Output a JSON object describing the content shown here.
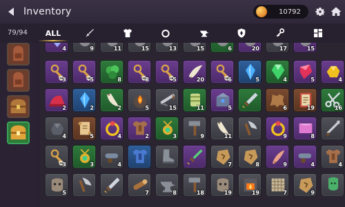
{
  "header": {
    "title": "Inventory",
    "coins": "10792"
  },
  "tabs": {
    "capacity": "79/94",
    "all_label": "ALL",
    "items": [
      {
        "id": "all",
        "icon": "all-tab"
      },
      {
        "id": "weapons",
        "icon": "sword-icon"
      },
      {
        "id": "armor",
        "icon": "armor-icon"
      },
      {
        "id": "rings",
        "icon": "ring-icon"
      },
      {
        "id": "anvil",
        "icon": "anvil-icon"
      },
      {
        "id": "shields",
        "icon": "shield-icon"
      },
      {
        "id": "keys",
        "icon": "key-icon"
      },
      {
        "id": "misc",
        "icon": "grid-icon"
      }
    ]
  },
  "sidebar": [
    {
      "icon": "backpack-icon",
      "active": false
    },
    {
      "icon": "backpack-icon",
      "active": false
    },
    {
      "icon": "chest-icon",
      "active": false
    },
    {
      "icon": "chest-icon",
      "active": true
    }
  ],
  "grid_partial_top": [
    {
      "icon": "gem-icon",
      "r": "purple",
      "qty": "4"
    },
    {
      "icon": "item-icon",
      "r": "gray",
      "qty": "9"
    },
    {
      "icon": "item-icon",
      "r": "gray",
      "qty": "11"
    },
    {
      "icon": "item-icon",
      "r": "gray",
      "qty": "15"
    },
    {
      "icon": "item-icon",
      "r": "gray",
      "qty": "13"
    },
    {
      "icon": "item-icon",
      "r": "gray",
      "qty": "15"
    },
    {
      "icon": "item-icon",
      "r": "green",
      "qty": "6"
    },
    {
      "icon": "item-icon",
      "r": "purple",
      "qty": "20"
    },
    {
      "icon": "item-icon",
      "r": "gray",
      "qty": "17"
    },
    {
      "icon": "item-icon",
      "r": "purple",
      "qty": "15"
    }
  ],
  "grid": [
    [
      {
        "icon": "key-skull-icon",
        "r": "purple",
        "qty": "3"
      },
      {
        "icon": "key-skull-icon",
        "r": "purple",
        "qty": "5"
      },
      {
        "icon": "herb-icon",
        "r": "green",
        "qty": "8"
      },
      {
        "icon": "key-skull-icon",
        "r": "purple",
        "qty": "8"
      },
      {
        "icon": "key-skull-icon",
        "r": "purple",
        "qty": "5"
      },
      {
        "icon": "horn-icon",
        "r": "purple",
        "qty": "20"
      },
      {
        "icon": "key-skull-icon",
        "r": "purple",
        "qty": "6"
      },
      {
        "icon": "crystal-blue-icon",
        "r": "blue",
        "qty": "5"
      },
      {
        "icon": "gem-green-icon",
        "r": "green",
        "qty": "4"
      },
      {
        "icon": "crystal-red-icon",
        "r": "purple",
        "qty": "5"
      },
      {
        "icon": "gold-nugget-icon",
        "r": "purple",
        "qty": "4"
      }
    ],
    [
      {
        "icon": "hat-red-icon",
        "r": "purple",
        "qty": "2"
      },
      {
        "icon": "crystal-blue-icon",
        "r": "blue",
        "qty": "2"
      },
      {
        "icon": "tusk-icon",
        "r": "green",
        "qty": "2"
      },
      {
        "icon": "ore-fire-icon",
        "r": "gray",
        "qty": "5"
      },
      {
        "icon": "saw-icon",
        "r": "gray",
        "qty": "15"
      },
      {
        "icon": "roll-cloth-icon",
        "r": "green",
        "qty": "11"
      },
      {
        "icon": "anvil-chest-icon",
        "r": "purple",
        "qty": "5"
      },
      {
        "icon": "dagger-icon",
        "r": "green",
        "qty": ""
      },
      {
        "icon": "leather-icon",
        "r": "brown",
        "qty": "6"
      },
      {
        "icon": "book-icon",
        "r": "brown",
        "qty": "19"
      },
      {
        "icon": "scissors-icon",
        "r": "green",
        "qty": "16"
      }
    ],
    [
      {
        "icon": "ore-rock-icon",
        "r": "gray",
        "qty": "4"
      },
      {
        "icon": "scroll-icon",
        "r": "brown",
        "qty": "5"
      },
      {
        "icon": "ring-gold-icon",
        "r": "purple",
        "qty": "4"
      },
      {
        "icon": "armor-chest-icon",
        "r": "purple",
        "qty": "2"
      },
      {
        "icon": "amulet-icon",
        "r": "green",
        "qty": "3"
      },
      {
        "icon": "hammer-icon",
        "r": "gray",
        "qty": "9"
      },
      {
        "icon": "tusk-icon",
        "r": "gray",
        "qty": "11"
      },
      {
        "icon": "axe-icon",
        "r": "gray",
        "qty": ""
      },
      {
        "icon": "ring-gold-icon",
        "r": "purple",
        "qty": "9"
      },
      {
        "icon": "cloth-pink-icon",
        "r": "purple",
        "qty": "8"
      },
      {
        "icon": "spear-icon",
        "r": "gray",
        "qty": ""
      }
    ],
    [
      {
        "icon": "key-skull-icon",
        "r": "gray",
        "qty": "3"
      },
      {
        "icon": "amulet-icon",
        "r": "green",
        "qty": "3"
      },
      {
        "icon": "cannon-icon",
        "r": "gray",
        "qty": "4"
      },
      {
        "icon": "armor-blue-icon",
        "r": "blue",
        "qty": ""
      },
      {
        "icon": "boot-icon",
        "r": "gray",
        "qty": ""
      },
      {
        "icon": "sword-green-icon",
        "r": "purple",
        "qty": ""
      },
      {
        "icon": "rune-icon",
        "r": "gray",
        "qty": "7"
      },
      {
        "icon": "rune-icon",
        "r": "gray",
        "qty": "8"
      },
      {
        "icon": "claw-icon",
        "r": "purple",
        "qty": "9"
      },
      {
        "icon": "cannon-icon",
        "r": "purple",
        "qty": "4"
      },
      {
        "icon": "armor-chest-icon",
        "r": "gray",
        "qty": "4"
      }
    ],
    [
      {
        "icon": "rock-face-icon",
        "r": "gray",
        "qty": "5"
      },
      {
        "icon": "axe-icon",
        "r": "gray",
        "qty": ""
      },
      {
        "icon": "dagger-icon",
        "r": "gray",
        "qty": ""
      },
      {
        "icon": "log-icon",
        "r": "gray",
        "qty": "7"
      },
      {
        "icon": "anvil-icon",
        "r": "gray",
        "qty": "8"
      },
      {
        "icon": "hammer-icon",
        "r": "gray",
        "qty": "18"
      },
      {
        "icon": "rock-face-icon",
        "r": "gray",
        "qty": "19"
      },
      {
        "icon": "furnace-icon",
        "r": "gray",
        "qty": "19"
      },
      {
        "icon": "mesh-icon",
        "r": "gray",
        "qty": "7"
      },
      {
        "icon": "rune-icon",
        "r": "gray",
        "qty": "9"
      },
      {
        "icon": "mask-green-icon",
        "r": "gray",
        "qty": ""
      }
    ]
  ]
}
